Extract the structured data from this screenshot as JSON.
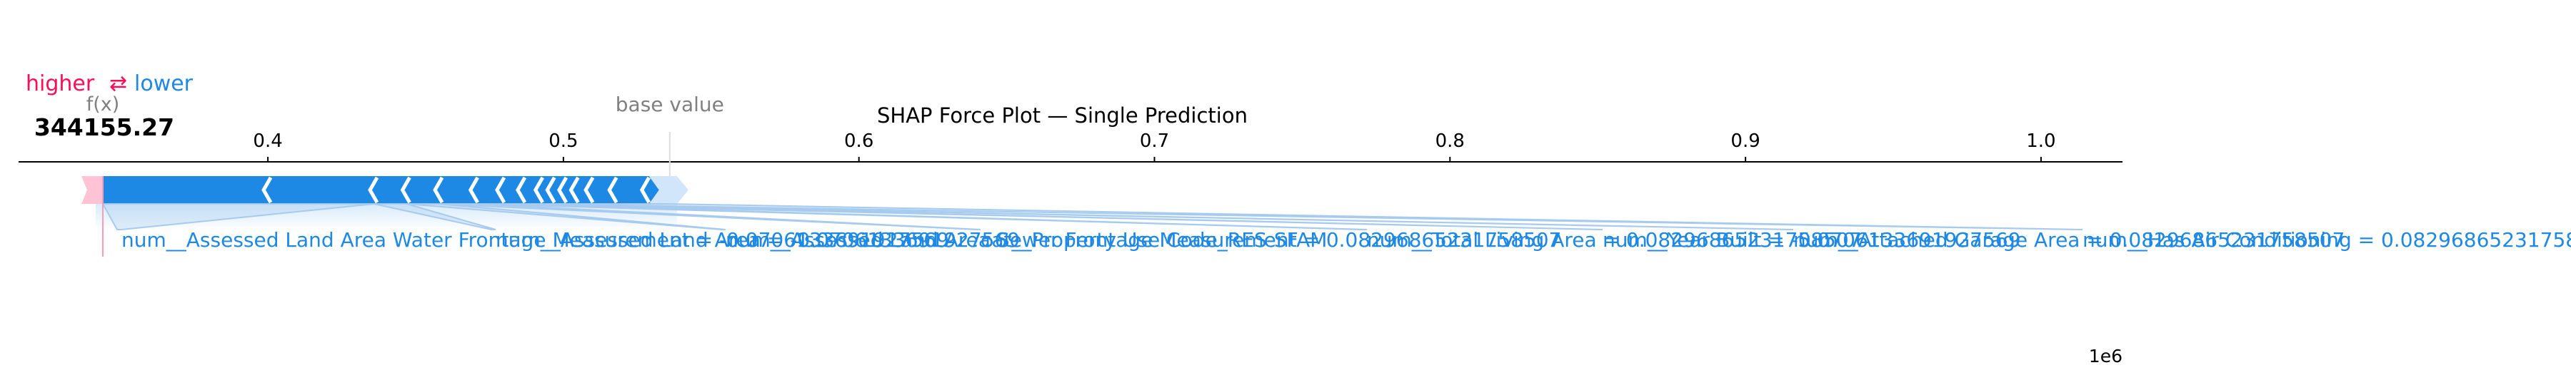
{
  "chart_data": {
    "type": "force",
    "title": "SHAP Force Plot — Single Prediction",
    "legend": {
      "higher": "higher",
      "arrows": "⇄",
      "lower": "lower"
    },
    "fx_label": "f(x)",
    "fx_value_text": "344155.27",
    "output_value": 344155.27,
    "base_value_label": "base value",
    "base_value": 536000,
    "axis": {
      "ticks": [
        0.4,
        0.5,
        0.6,
        0.7,
        0.8,
        0.9,
        1.0
      ],
      "tick_labels": [
        "0.4",
        "0.5",
        "0.6",
        "0.7",
        "0.8",
        "0.9",
        "1.0"
      ],
      "multiplier": "1e6",
      "xlim": [
        0.345,
        1.055
      ]
    },
    "colors": {
      "positive": "#ff0d57",
      "negative": "#1e88e5",
      "negative_light": "#d1e6fa",
      "label_link": "#a6cbef",
      "fx_line": "#ff9ab5",
      "base_line": "#dddddd",
      "text": "#000000",
      "axis_gray": "#808080"
    },
    "segments_negative_boundaries": [
      536000,
      528000,
      517000,
      509000,
      504000,
      500000,
      496000,
      492000,
      486000,
      479000,
      470000,
      458000,
      447000,
      436000,
      400000,
      344155.27
    ],
    "features": [
      {
        "label": "num__Assessed Land Area Water Frontage Measurement = -0.0706133691927569",
        "start": 436000,
        "end": 344155.27
      },
      {
        "label": "num__Assessed Land Area = -0.0706133691927569",
        "start": 447000,
        "end": 436000
      },
      {
        "label": "num__Assessed Land Area Sewer Frontage Measurement = 0.08296865231758507",
        "start": 458000,
        "end": 447000
      },
      {
        "label": "cat__Property Use Code_RES-SFAM",
        "start": 470000,
        "end": 458000
      },
      {
        "label": "num__Total Living Area = 0.08296865231758507",
        "start": 479000,
        "end": 470000
      },
      {
        "label": "num__Year Built = -0.0706133691927569",
        "start": 486000,
        "end": 479000
      },
      {
        "label": "num__Attached Garage Area = 0.08296865231758507",
        "start": 492000,
        "end": 486000
      },
      {
        "label": "num__Has Air Conditioning = 0.08296865231758507",
        "start": 536000,
        "end": 492000
      }
    ]
  }
}
